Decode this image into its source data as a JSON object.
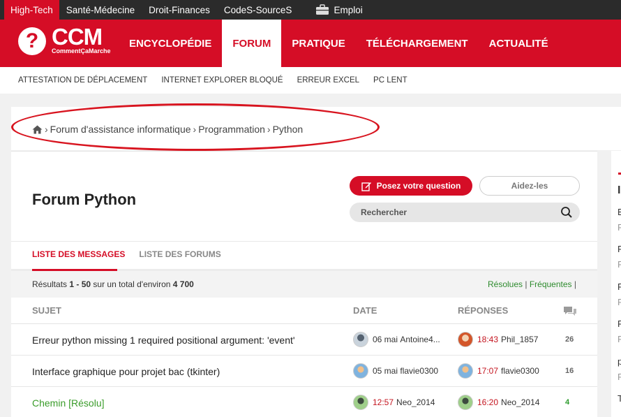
{
  "topbar": {
    "items": [
      "High-Tech",
      "Santé-Médecine",
      "Droit-Finances",
      "CodeS-SourceS"
    ],
    "emploi": "Emploi"
  },
  "logo": {
    "mark": "?",
    "name": "CCM",
    "tagline": "CommentÇaMarche"
  },
  "nav": [
    "ENCYCLOPÉDIE",
    "FORUM",
    "PRATIQUE",
    "TÉLÉCHARGEMENT",
    "ACTUALITÉ"
  ],
  "subnav": [
    "ATTESTATION DE DÉPLACEMENT",
    "INTERNET EXPLORER BLOQUÉ",
    "ERREUR EXCEL",
    "PC LENT"
  ],
  "breadcrumb": [
    "Forum d'assistance informatique",
    "Programmation",
    "Python"
  ],
  "page": {
    "title": "Forum Python",
    "ask_button": "Posez votre question",
    "help_button": "Aidez-les",
    "search_placeholder": "Rechercher"
  },
  "tabs": [
    "LISTE DES MESSAGES",
    "LISTE DES FORUMS"
  ],
  "results": {
    "prefix": "Résultats",
    "range": "1 - 50",
    "middle": "sur un total d'environ",
    "total": "4 700"
  },
  "filters": {
    "resolved": "Résolues",
    "sep": "|",
    "frequent": "Fréquentes",
    "end": "|"
  },
  "table": {
    "headers": {
      "subject": "SUJET",
      "date": "DATE",
      "replies": "RÉPONSES"
    },
    "rows": [
      {
        "subject": "Erreur python missing 1 required positional argument: 'event'",
        "date": "06 mai",
        "author": "Antoine4...",
        "reply_time": "18:43",
        "reply_author": "Phil_1857",
        "count": "26",
        "resolved": false
      },
      {
        "subject": "Interface graphique pour projet bac (tkinter)",
        "date": "05 mai",
        "author": "flavie0300",
        "reply_time": "17:07",
        "reply_author": "flavie0300",
        "count": "16",
        "resolved": false
      },
      {
        "subject": "Chemin [Résolu]",
        "date": "12:57",
        "author": "Neo_2014",
        "reply_time": "16:20",
        "reply_author": "Neo_2014",
        "count": "4",
        "resolved": true
      }
    ]
  },
  "sidebar_letters": [
    "I",
    "B",
    "F",
    "R",
    "F",
    "R",
    "F",
    "R",
    "F",
    "p",
    "F",
    "T"
  ],
  "colors": {
    "brand": "#d50d26",
    "dark": "#2b2b2b",
    "resolved": "#3a9c2a",
    "annotation": "#d8141f"
  }
}
